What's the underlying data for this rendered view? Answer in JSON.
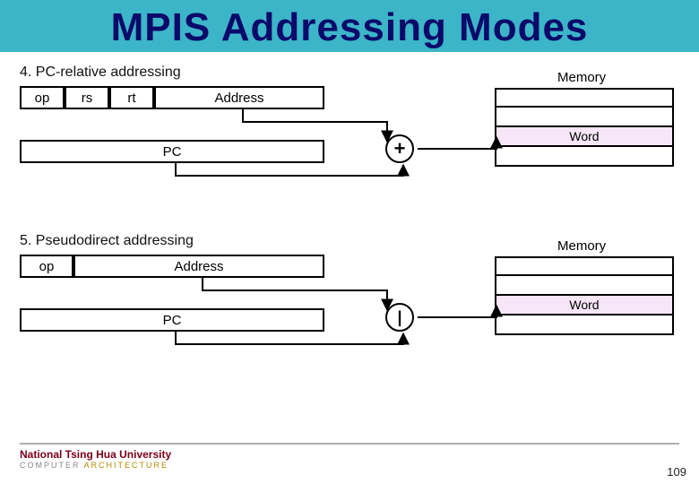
{
  "title": "MPIS Addressing Modes",
  "section4": {
    "label": "4. PC-relative addressing",
    "fields": {
      "op": "op",
      "rs": "rs",
      "rt": "rt",
      "addr": "Address"
    },
    "pc": "PC",
    "memory_label": "Memory",
    "word_label": "Word",
    "operator": "+"
  },
  "section5": {
    "label": "5. Pseudodirect addressing",
    "fields": {
      "op": "op",
      "addr": "Address"
    },
    "pc": "PC",
    "memory_label": "Memory",
    "word_label": "Word",
    "operator": "|"
  },
  "footer": {
    "org": "National Tsing Hua University",
    "dept_a": "COMPUTER",
    "dept_b": "ARCHITECTURE",
    "page": "109"
  }
}
